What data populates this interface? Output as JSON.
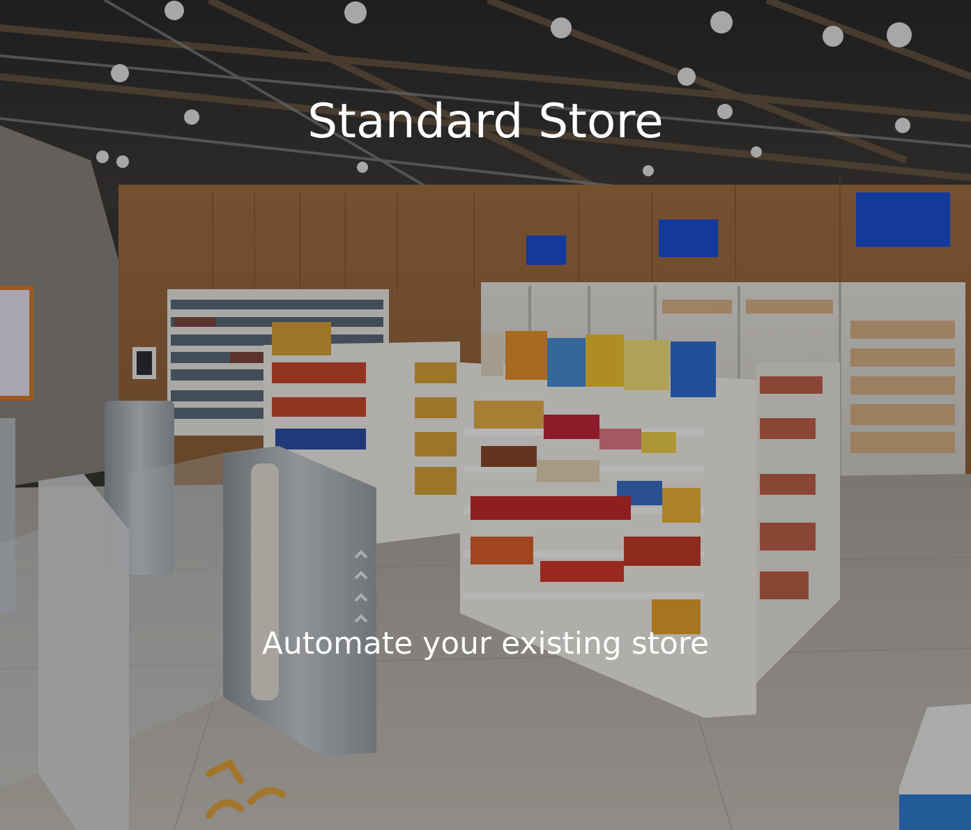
{
  "hero": {
    "title": "Standard Store",
    "subtitle": "Automate your existing store",
    "background_image": "convenience-store-interior-photo"
  },
  "colors": {
    "text": "#ffffff",
    "overlay": "#000000",
    "wood": "#b07a4a",
    "shelf": "#f2f0ec",
    "floor": "#b8b3ad",
    "ceiling": "#2c2c2e",
    "signage": "#1c4fd8"
  }
}
